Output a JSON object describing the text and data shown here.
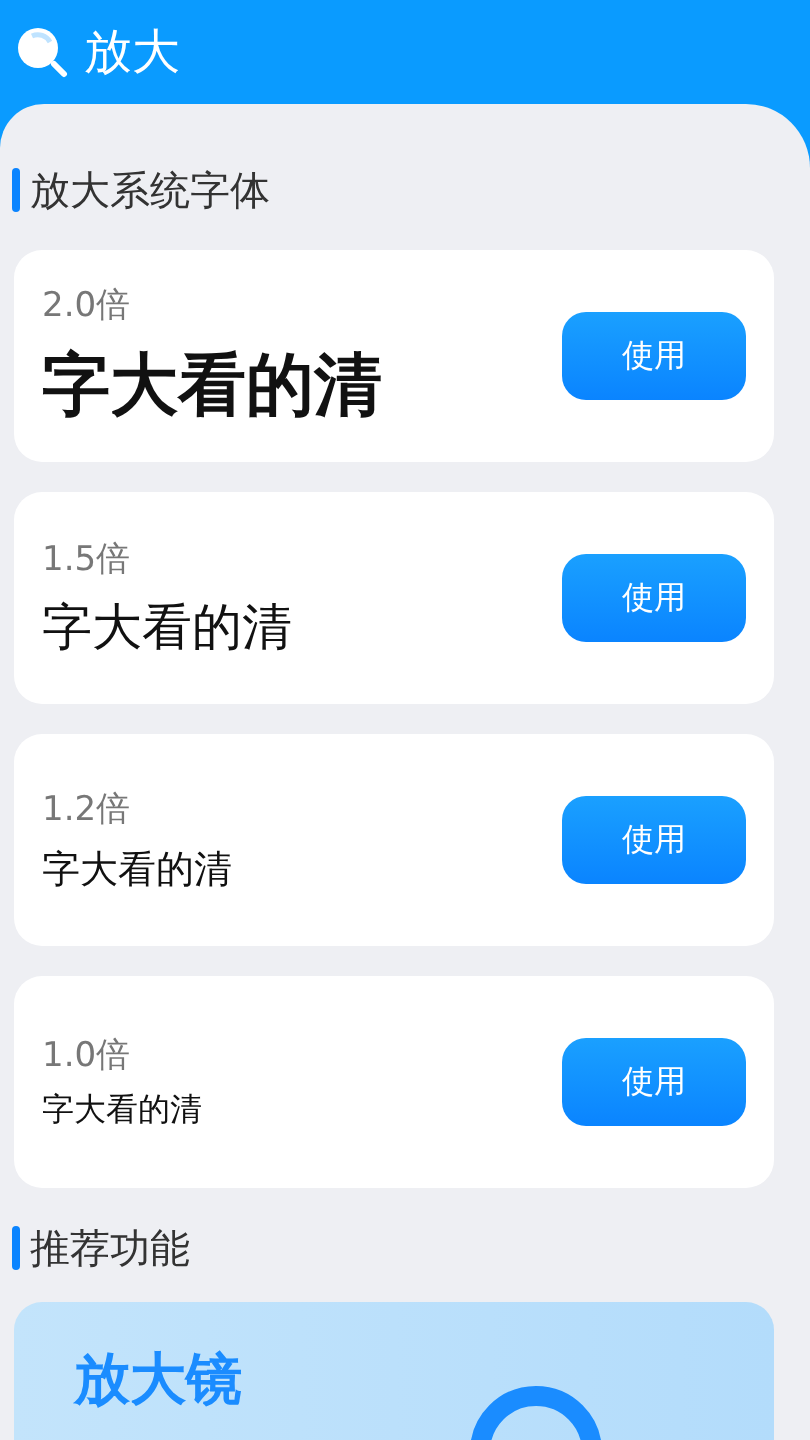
{
  "header": {
    "title": "放大"
  },
  "sections": [
    {
      "title": "放大系统字体"
    },
    {
      "title": "推荐功能"
    }
  ],
  "font_options": [
    {
      "kind": "xl",
      "factor": "2.0倍",
      "sample": "字大看的清",
      "button": "使用"
    },
    {
      "kind": "l",
      "factor": "1.5倍",
      "sample": "字大看的清",
      "button": "使用"
    },
    {
      "kind": "m",
      "factor": "1.2倍",
      "sample": "字大看的清",
      "button": "使用"
    },
    {
      "kind": "s",
      "factor": "1.0倍",
      "sample": "字大看的清",
      "button": "使用"
    }
  ],
  "feature": {
    "title": "放大镜"
  }
}
